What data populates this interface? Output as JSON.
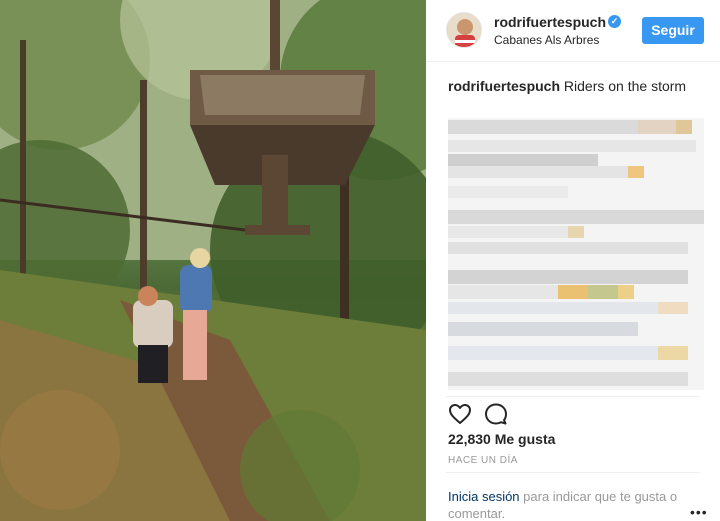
{
  "post": {
    "username": "rodrifuertespuch",
    "location": "Cabanes Als Arbres",
    "follow_label": "Seguir",
    "caption_user": "rodrifuertespuch",
    "caption_text": "Riders on the storm",
    "likes": "22,830 Me gusta",
    "time": "HACE UN DÍA",
    "login_link": "Inicia sesión",
    "login_rest": " para indicar que te gusta o comentar.",
    "more": "•••"
  },
  "icons": {
    "verified": "verified-badge-icon",
    "like": "heart-icon",
    "comment": "comment-icon",
    "more": "more-options-icon"
  },
  "colors": {
    "accent": "#3897f0",
    "link": "#003569",
    "muted": "#999999"
  }
}
